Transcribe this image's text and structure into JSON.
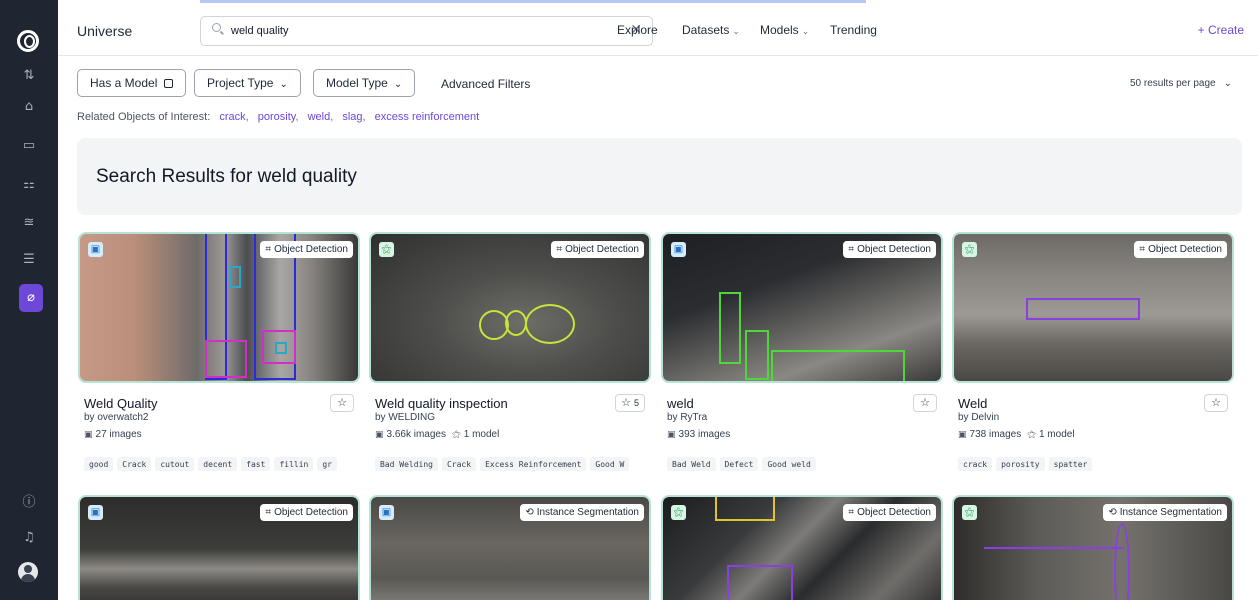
{
  "header": {
    "brand": "Universe",
    "search": {
      "value": "weld quality",
      "placeholder": ""
    },
    "nav": [
      {
        "label": "Explore",
        "dropdown": false
      },
      {
        "label": "Datasets",
        "dropdown": true
      },
      {
        "label": "Models",
        "dropdown": true
      },
      {
        "label": "Trending",
        "dropdown": false
      }
    ],
    "create_label": "+ Create"
  },
  "sidebar": {
    "items": [
      {
        "icon": "sort-icon",
        "glyph": "⇅"
      },
      {
        "icon": "home-icon",
        "glyph": "⌂"
      },
      {
        "icon": "inbox-icon",
        "glyph": "▭"
      },
      {
        "icon": "workflow-icon",
        "glyph": "⚏"
      },
      {
        "icon": "chart-icon",
        "glyph": "≊"
      },
      {
        "icon": "database-icon",
        "glyph": "☰"
      },
      {
        "icon": "universe-icon",
        "glyph": "⌀",
        "active": true
      }
    ],
    "bottom": [
      {
        "icon": "help-icon",
        "glyph": "ⓘ"
      },
      {
        "icon": "bell-icon",
        "glyph": "♫"
      }
    ]
  },
  "filters": {
    "has_model": "Has a Model",
    "project_type": "Project Type",
    "model_type": "Model Type",
    "advanced": "Advanced Filters",
    "per_page": "50 results per page"
  },
  "related": {
    "label": "Related Objects of Interest:",
    "items": [
      "crack",
      "porosity",
      "weld",
      "slag",
      "excess reinforcement"
    ]
  },
  "results_title": "Search Results for weld quality",
  "colors": {
    "accent": "#6d48d8",
    "sidebar": "#1f2631",
    "card_border": "#b5e3d5"
  },
  "cards": [
    {
      "title": "Weld Quality",
      "by": "by overwatch2",
      "images": "27 images",
      "models": "",
      "type": "Object Detection",
      "badge": "img",
      "stars": "",
      "tags": [
        "good",
        "Crack",
        "cutout",
        "decent",
        "fast",
        "fillin",
        "gr"
      ]
    },
    {
      "title": "Weld quality inspection",
      "by": "by WELDING",
      "images": "3.66k images",
      "models": "1 model",
      "type": "Object Detection",
      "badge": "mdl",
      "stars": "5",
      "tags": [
        "Bad Welding",
        "Crack",
        "Excess Reinforcement",
        "Good W"
      ]
    },
    {
      "title": "weld",
      "by": "by RyTra",
      "images": "393 images",
      "models": "",
      "type": "Object Detection",
      "badge": "img",
      "stars": "",
      "tags": [
        "Bad Weld",
        "Defect",
        "Good weld"
      ]
    },
    {
      "title": "Weld",
      "by": "by Delvin",
      "images": "738 images",
      "models": "1 model",
      "type": "Object Detection",
      "badge": "mdl",
      "stars": "",
      "tags": [
        "crack",
        "porosity",
        "spatter"
      ]
    },
    {
      "type": "Object Detection",
      "badge": "img"
    },
    {
      "type": "Instance Segmentation",
      "badge": "img"
    },
    {
      "type": "Object Detection",
      "badge": "mdl"
    },
    {
      "type": "Instance Segmentation",
      "badge": "mdl"
    }
  ]
}
